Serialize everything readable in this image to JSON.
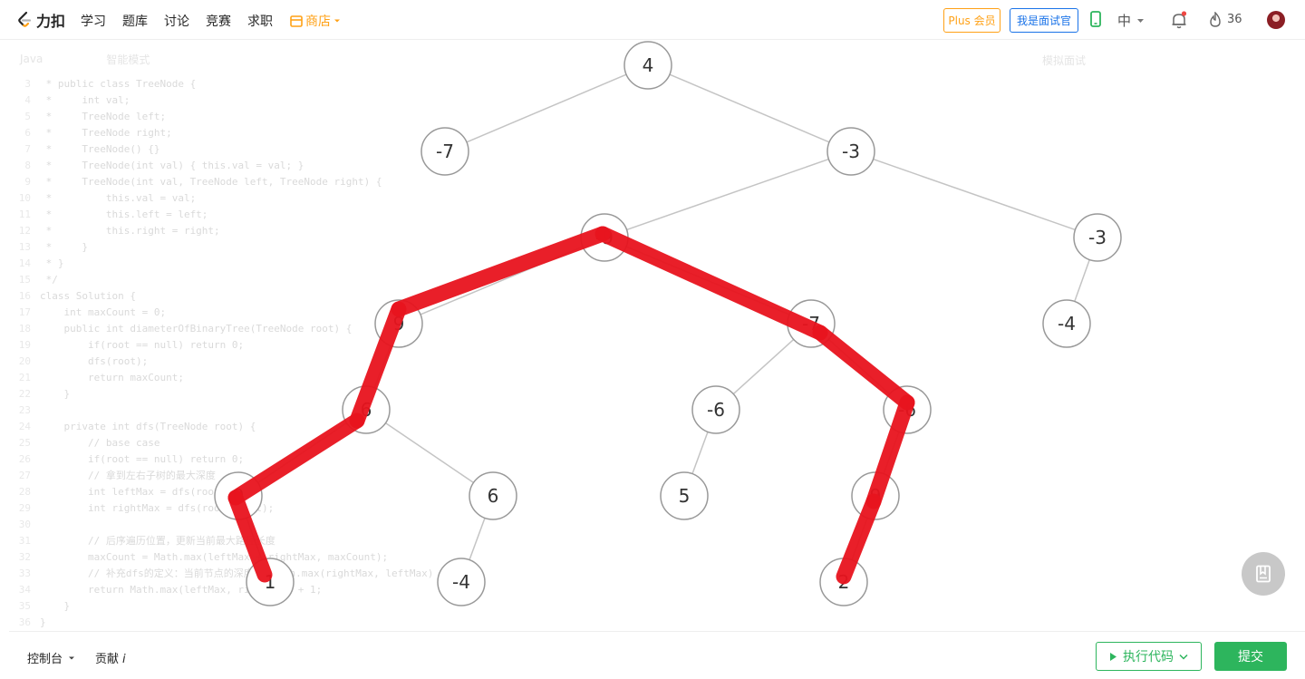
{
  "nav": {
    "logo_text": "力扣",
    "items": [
      "学习",
      "题库",
      "讨论",
      "竞赛",
      "求职"
    ],
    "shop": "商店",
    "plus": "Plus 会员",
    "interviewer": "我是面试官",
    "lang": "中",
    "streak": "36",
    "accent": "#ffa116"
  },
  "editor": {
    "language": "Java",
    "mode": "智能模式",
    "mock": "模拟面试",
    "code": [
      {
        "n": "3",
        "t": " * public class TreeNode {"
      },
      {
        "n": "4",
        "t": " *     int val;"
      },
      {
        "n": "5",
        "t": " *     TreeNode left;"
      },
      {
        "n": "6",
        "t": " *     TreeNode right;"
      },
      {
        "n": "7",
        "t": " *     TreeNode() {}"
      },
      {
        "n": "8",
        "t": " *     TreeNode(int val) { this.val = val; }"
      },
      {
        "n": "9",
        "t": " *     TreeNode(int val, TreeNode left, TreeNode right) {"
      },
      {
        "n": "10",
        "t": " *         this.val = val;"
      },
      {
        "n": "11",
        "t": " *         this.left = left;"
      },
      {
        "n": "12",
        "t": " *         this.right = right;"
      },
      {
        "n": "13",
        "t": " *     }"
      },
      {
        "n": "14",
        "t": " * }"
      },
      {
        "n": "15",
        "t": " */"
      },
      {
        "n": "16",
        "t": "class Solution {"
      },
      {
        "n": "17",
        "t": "    int maxCount = 0;"
      },
      {
        "n": "18",
        "t": "    public int diameterOfBinaryTree(TreeNode root) {"
      },
      {
        "n": "19",
        "t": "        if(root == null) return 0;"
      },
      {
        "n": "20",
        "t": "        dfs(root);"
      },
      {
        "n": "21",
        "t": "        return maxCount;"
      },
      {
        "n": "22",
        "t": "    }"
      },
      {
        "n": "23",
        "t": ""
      },
      {
        "n": "24",
        "t": "    private int dfs(TreeNode root) {"
      },
      {
        "n": "25",
        "t": "        // base case"
      },
      {
        "n": "26",
        "t": "        if(root == null) return 0;"
      },
      {
        "n": "27",
        "t": "        // 拿到左右子树的最大深度"
      },
      {
        "n": "28",
        "t": "        int leftMax = dfs(root.left);"
      },
      {
        "n": "29",
        "t": "        int rightMax = dfs(root.right);"
      },
      {
        "n": "30",
        "t": ""
      },
      {
        "n": "31",
        "t": "        // 后序遍历位置，更新当前最大路径长度"
      },
      {
        "n": "32",
        "t": "        maxCount = Math.max(leftMax + rightMax, maxCount);"
      },
      {
        "n": "33",
        "t": "        // 补充dfs的定义：当前节点的深度 + Math.max(rightMax, leftMax)"
      },
      {
        "n": "34",
        "t": "        return Math.max(leftMax, rightMax) + 1;"
      },
      {
        "n": "35",
        "t": "    }"
      },
      {
        "n": "36",
        "t": "}"
      }
    ]
  },
  "tree": {
    "path_color": "#e8141e",
    "nodes": [
      {
        "id": "n4",
        "label": "4"
      },
      {
        "id": "nm7a",
        "label": "-7"
      },
      {
        "id": "nm3a",
        "label": "-3"
      },
      {
        "id": "nm9",
        "label": "-9"
      },
      {
        "id": "nm3b",
        "label": "-3"
      },
      {
        "id": "n9a",
        "label": "9"
      },
      {
        "id": "nm7b",
        "label": "-7"
      },
      {
        "id": "nm4a",
        "label": "-4"
      },
      {
        "id": "n6a",
        "label": "6"
      },
      {
        "id": "nm6a",
        "label": "-6"
      },
      {
        "id": "nm6b",
        "label": "-6"
      },
      {
        "id": "n0",
        "label": "0"
      },
      {
        "id": "n6b",
        "label": "6"
      },
      {
        "id": "n5",
        "label": "5"
      },
      {
        "id": "n9b",
        "label": "9"
      },
      {
        "id": "n1",
        "label": "1"
      },
      {
        "id": "nm4b",
        "label": "-4"
      },
      {
        "id": "n2",
        "label": "2"
      }
    ],
    "edges": [
      [
        "n4",
        "nm7a"
      ],
      [
        "n4",
        "nm3a"
      ],
      [
        "nm3a",
        "nm9"
      ],
      [
        "nm3a",
        "nm3b"
      ],
      [
        "nm9",
        "n9a"
      ],
      [
        "nm9",
        "nm7b"
      ],
      [
        "nm3b",
        "nm4a"
      ],
      [
        "n9a",
        "n6a"
      ],
      [
        "nm7b",
        "nm6a"
      ],
      [
        "nm7b",
        "nm6b"
      ],
      [
        "n6a",
        "n0"
      ],
      [
        "n6a",
        "n6b"
      ],
      [
        "nm6a",
        "n5"
      ],
      [
        "nm6b",
        "n9b"
      ],
      [
        "n0",
        "n1"
      ],
      [
        "n6b",
        "nm4b"
      ],
      [
        "n9b",
        "n2"
      ]
    ],
    "highlighted_path": [
      "n1",
      "n0",
      "n6a",
      "n9a",
      "nm9",
      "nm7b",
      "nm6b",
      "n9b",
      "n2"
    ]
  },
  "bottom": {
    "console": "控制台",
    "contribute": "贡献",
    "contribute_mark": "i",
    "run": "执行代码",
    "submit": "提交",
    "green": "#2db55d"
  }
}
